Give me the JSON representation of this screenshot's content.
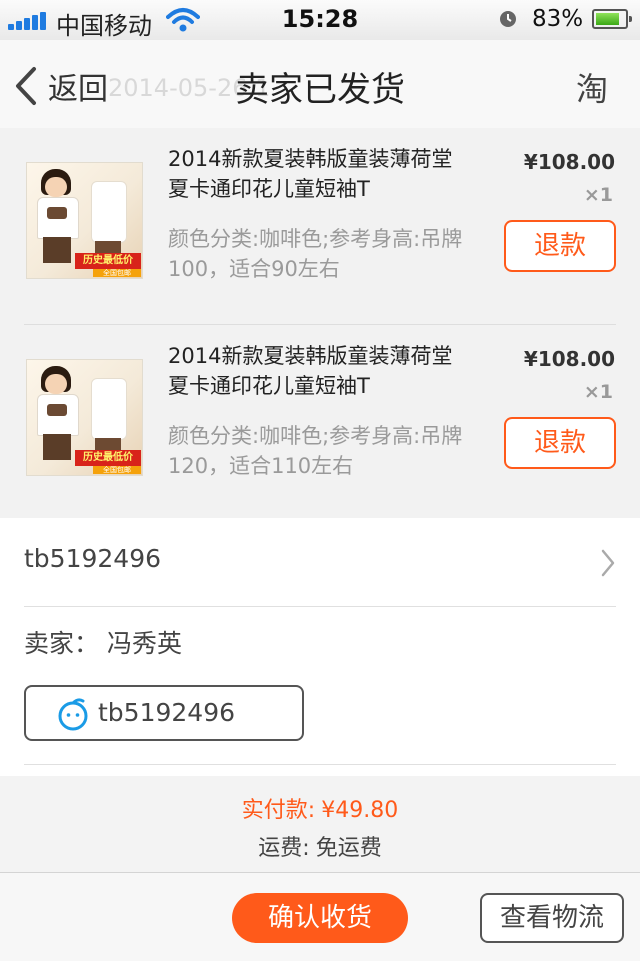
{
  "status_bar": {
    "carrier": "中国移动",
    "time": "15:28",
    "battery_percent": "83%",
    "battery_level": 0.83,
    "icons": [
      "signal-icon",
      "wifi-icon",
      "alarm-icon",
      "battery-icon"
    ]
  },
  "nav": {
    "back_label": "返回",
    "ghost_date": "2014-05-26 1",
    "title": "卖家已发货",
    "right_icon_glyph": "淘"
  },
  "items": [
    {
      "title": "2014新款夏装韩版童装薄荷堂夏卡通印花儿童短袖T",
      "sku": "颜色分类:咖啡色;参考身高:吊牌100，适合90左右",
      "price": "¥108.00",
      "qty": "×1",
      "refund_label": "退款",
      "thumb_banner": "历史最低价",
      "thumb_sub": "全国包邮"
    },
    {
      "title": "2014新款夏装韩版童装薄荷堂夏卡通印花儿童短袖T",
      "sku": "颜色分类:咖啡色;参考身高:吊牌120，适合110左右",
      "price": "¥108.00",
      "qty": "×1",
      "refund_label": "退款",
      "thumb_banner": "历史最低价",
      "thumb_sub": "全国包邮"
    }
  ],
  "seller": {
    "shop_id": "tb5192496",
    "name_line": "卖家：  冯秀英",
    "wangwang_id": "tb5192496"
  },
  "summary": {
    "paid_label": "实付款:",
    "paid_value": "¥49.80",
    "shipping_label": "运费:",
    "shipping_value": "免运费"
  },
  "actions": {
    "confirm_label": "确认收货",
    "logistics_label": "查看物流"
  },
  "colors": {
    "accent": "#ff5a1a",
    "ios_blue": "#1f7be0",
    "battery_green": "#3aa816"
  }
}
